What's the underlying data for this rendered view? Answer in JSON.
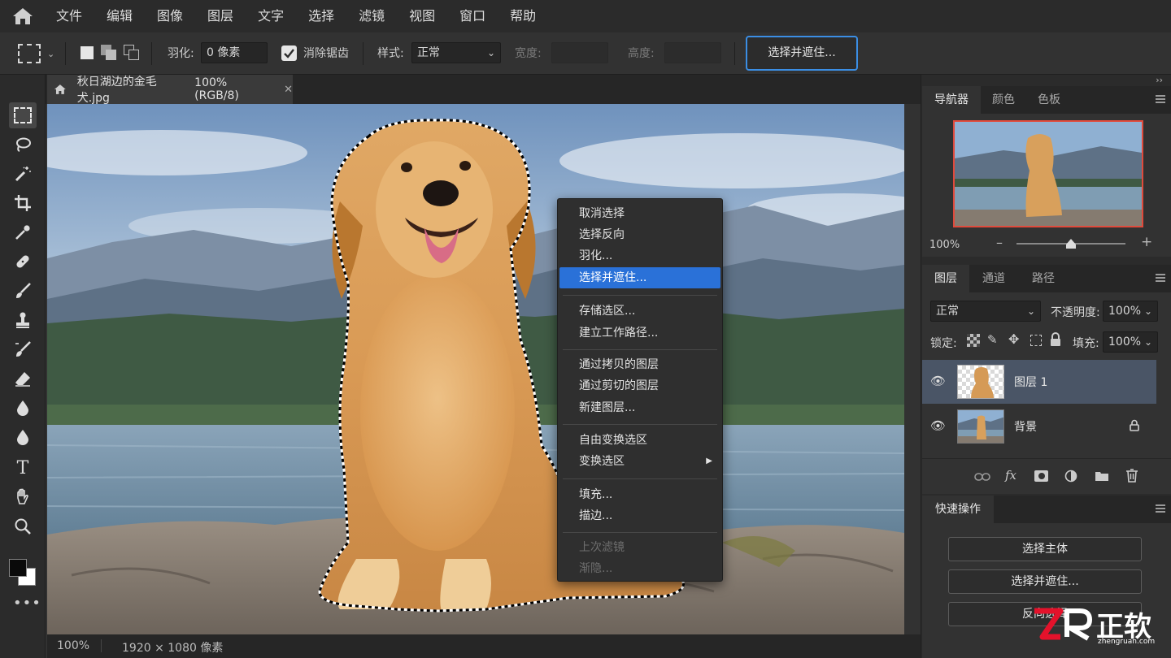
{
  "menubar": {
    "items": [
      "文件",
      "编辑",
      "图像",
      "图层",
      "文字",
      "选择",
      "滤镜",
      "视图",
      "窗口",
      "帮助"
    ]
  },
  "options": {
    "feather_label": "羽化:",
    "feather_value": "0 像素",
    "antialias_label": "消除锯齿",
    "antialias_checked": true,
    "style_label": "样式:",
    "style_value": "正常",
    "width_label": "宽度:",
    "height_label": "高度:",
    "select_mask_button": "选择并遮住..."
  },
  "document": {
    "tab_title": "秋日湖边的金毛犬.jpg",
    "tab_info": "100% (RGB/8)",
    "zoom": "100%",
    "size": "1920 × 1080 像素"
  },
  "context_menu": {
    "items": [
      {
        "label": "取消选择",
        "state": "normal"
      },
      {
        "label": "选择反向",
        "state": "normal"
      },
      {
        "label": "羽化...",
        "state": "normal"
      },
      {
        "label": "选择并遮住...",
        "state": "highlighted"
      },
      {
        "label": "存储选区...",
        "state": "normal"
      },
      {
        "label": "建立工作路径...",
        "state": "normal"
      },
      {
        "label": "通过拷贝的图层",
        "state": "normal"
      },
      {
        "label": "通过剪切的图层",
        "state": "normal"
      },
      {
        "label": "新建图层...",
        "state": "normal"
      },
      {
        "label": "自由变换选区",
        "state": "normal"
      },
      {
        "label": "变换选区",
        "state": "normal",
        "submenu": true
      },
      {
        "label": "填充...",
        "state": "normal"
      },
      {
        "label": "描边...",
        "state": "normal"
      },
      {
        "label": "上次滤镜",
        "state": "disabled"
      },
      {
        "label": "渐隐...",
        "state": "disabled"
      }
    ]
  },
  "navigator": {
    "tabs": [
      "导航器",
      "颜色",
      "色板"
    ],
    "zoom": "100%",
    "zoom_level": 0.5
  },
  "layers": {
    "tabs": [
      "图层",
      "通道",
      "路径"
    ],
    "blend_mode": "正常",
    "opacity_label": "不透明度:",
    "opacity_value": "100%",
    "lock_label": "锁定:",
    "fill_label": "填充:",
    "fill_value": "100%",
    "items": [
      {
        "name": "图层 1",
        "selected": true,
        "locked": false
      },
      {
        "name": "背景",
        "selected": false,
        "locked": true
      }
    ]
  },
  "quick_actions": {
    "title": "快速操作",
    "buttons": [
      "选择主体",
      "选择并遮住...",
      "反向选择"
    ]
  },
  "watermark": {
    "text": "正软",
    "sub": "zhengruan.com"
  },
  "colors": {
    "accent": "#2a71d8",
    "focus_ring": "#3b8ee4",
    "navigator_frame": "#e04a3c"
  }
}
